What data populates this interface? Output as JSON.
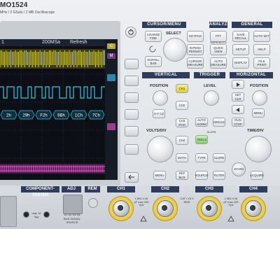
{
  "device": {
    "model": "MO1524",
    "subtitle": "MHz / 2 GSa/s / 2 MB Oscilloscope"
  },
  "screen": {
    "status_left": "1",
    "status_sample": "200MSa",
    "status_mode": "Refresh",
    "decode_labels": [
      "2h",
      "29h",
      "F2h",
      "9Bh",
      "1Ch",
      "7Ch"
    ],
    "side_tags": [
      "C",
      "M"
    ]
  },
  "panel": {
    "cursor_menu": {
      "title": "CURSOR/MENU",
      "coarse_fine": "COARSE FINE",
      "select": "SELECT",
      "keypad": "KEYPAD",
      "intensity": "INTENS PERSIST",
      "cursor_measure": "CURSOR MEASURE",
      "scroll_bar": "SCROLL BAR"
    },
    "analyze": {
      "title": "ANALYZE",
      "fft": "FFT",
      "mask_label": "MASK/AUTO",
      "quick_view": "QUICK VIEW",
      "auto_measure": "AUTO MEASURE"
    },
    "general": {
      "title": "GENERAL",
      "save_recall": "SAVE RECALL",
      "autoset": "AUTO SET",
      "setup": "SETUP",
      "help": "HELP",
      "display": "DISPLAY",
      "file_print": "FILE PRINT"
    },
    "vertical": {
      "title": "VERTICAL",
      "position": "POSITION",
      "ch1": "CH1",
      "ch2": "CH2",
      "ch3": "CH3",
      "ch4": "CH4",
      "xy_cz": "X-Y CZ",
      "ch3_pod": "CH3 POD",
      "math": "MATH",
      "menu": "MENU",
      "ref_bus": "REF BUS",
      "volts_div": "VOLTS/DIV"
    },
    "trigger": {
      "title": "TRIGGER",
      "level": "LEVEL",
      "auto_normal": "AUTO NORM",
      "single": "SINGLE",
      "trig_d": "TRIG'd",
      "slope_label": "SLOPE",
      "type": "TYPE",
      "slope": "SLOPE",
      "source": "SOURCE",
      "filter": "FILTER"
    },
    "horizontal": {
      "title": "HORIZONTAL",
      "position": "POSITION",
      "set_clr": "SET CLR",
      "menu": "MENU",
      "run_stop": "RUN STOP",
      "time_div": "TIME/DIV",
      "zoom": "ZOOM",
      "acquire": "ACQUIRE"
    }
  },
  "bottom": {
    "component_tester": "COMPONENT-TESTER",
    "adj": "ADJ",
    "rem": "REM",
    "channels": [
      "CH1",
      "CH2",
      "CH3",
      "CH4"
    ],
    "input_spec": "1 MΩ II 16 pF max 200 Vpk",
    "cat_spec": "CAT I ≤5 V RMS",
    "bus_signal": "BUS SIGNAL SOURCE",
    "pins": [
      "S1",
      "S2",
      "S3",
      "S4"
    ],
    "aux_label": "max 10 Vpp"
  },
  "colors": {
    "navy_header": "#2f3d5c",
    "bnc_gold": "#f0d24e",
    "trace_yellow": "#e8e23a",
    "trace_cyan": "#32c8e6",
    "trace_magenta": "#e050c8"
  }
}
